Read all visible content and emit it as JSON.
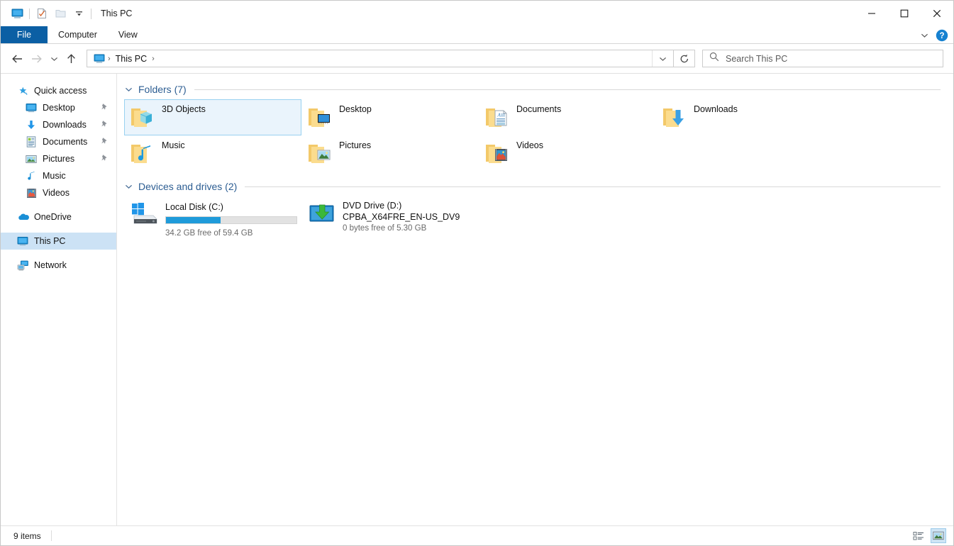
{
  "window": {
    "title": "This PC",
    "quick_access_toolbar": [
      {
        "name": "this-pc-icon",
        "tooltip": "This PC"
      },
      {
        "name": "properties-icon",
        "tooltip": "Properties"
      },
      {
        "name": "new-folder-icon",
        "tooltip": "New folder"
      },
      {
        "name": "customize-dropdown-icon",
        "tooltip": "Customize Quick Access Toolbar"
      }
    ],
    "controls": {
      "minimize": "—",
      "maximize": "□",
      "close": "✕"
    }
  },
  "ribbon": {
    "tabs": [
      {
        "label": "File",
        "active": true
      },
      {
        "label": "Computer",
        "active": false
      },
      {
        "label": "View",
        "active": false
      }
    ],
    "expand_icon": "chevron-down-icon",
    "help_label": "?"
  },
  "navigation": {
    "back_icon": "←",
    "forward_icon": "→",
    "recent_icon": "⌄",
    "up_icon": "↑",
    "breadcrumb": {
      "icon": "this-pc-icon",
      "items": [
        "This PC"
      ],
      "separator": "›"
    },
    "dropdown_icon": "chevron-down-icon",
    "refresh_icon": "↻"
  },
  "search": {
    "placeholder": "Search This PC",
    "icon": "search-icon",
    "value": ""
  },
  "sidebar": {
    "items": [
      {
        "label": "Quick access",
        "icon": "star-pin-icon",
        "indent": false,
        "pinned": false,
        "selected": false
      },
      {
        "label": "Desktop",
        "icon": "desktop-icon",
        "indent": true,
        "pinned": true,
        "selected": false
      },
      {
        "label": "Downloads",
        "icon": "download-icon",
        "indent": true,
        "pinned": true,
        "selected": false
      },
      {
        "label": "Documents",
        "icon": "documents-icon",
        "indent": true,
        "pinned": true,
        "selected": false
      },
      {
        "label": "Pictures",
        "icon": "pictures-icon",
        "indent": true,
        "pinned": true,
        "selected": false
      },
      {
        "label": "Music",
        "icon": "music-icon",
        "indent": true,
        "pinned": false,
        "selected": false
      },
      {
        "label": "Videos",
        "icon": "videos-icon",
        "indent": true,
        "pinned": false,
        "selected": false
      },
      {
        "label": "OneDrive",
        "icon": "onedrive-cloud-icon",
        "indent": false,
        "pinned": false,
        "selected": false
      },
      {
        "label": "This PC",
        "icon": "this-pc-icon",
        "indent": false,
        "pinned": false,
        "selected": true
      },
      {
        "label": "Network",
        "icon": "network-icon",
        "indent": false,
        "pinned": false,
        "selected": false
      }
    ]
  },
  "main": {
    "groups": [
      {
        "title": "Folders (7)",
        "collapsed": false,
        "items": [
          {
            "label": "3D Objects",
            "icon": "folder-3d-objects-icon",
            "selected": true
          },
          {
            "label": "Desktop",
            "icon": "folder-desktop-icon",
            "selected": false
          },
          {
            "label": "Documents",
            "icon": "folder-documents-icon",
            "selected": false
          },
          {
            "label": "Downloads",
            "icon": "folder-downloads-icon",
            "selected": false
          },
          {
            "label": "Music",
            "icon": "folder-music-icon",
            "selected": false
          },
          {
            "label": "Pictures",
            "icon": "folder-pictures-icon",
            "selected": false
          },
          {
            "label": "Videos",
            "icon": "folder-videos-icon",
            "selected": false
          }
        ]
      },
      {
        "title": "Devices and drives (2)",
        "collapsed": false,
        "drives": [
          {
            "name": "Local Disk (C:)",
            "icon": "hard-disk-icon",
            "has_bar": true,
            "used_percent": 42,
            "capacity_text": "34.2 GB free of 59.4 GB",
            "subtitle": "",
            "bar_color": "#1f9bda"
          },
          {
            "name": "DVD Drive (D:)",
            "icon": "dvd-drive-icon",
            "has_bar": false,
            "used_percent": 100,
            "capacity_text": "0 bytes free of 5.30 GB",
            "subtitle": "CPBA_X64FRE_EN-US_DV9",
            "bar_color": "#1f9bda"
          }
        ]
      }
    ]
  },
  "status": {
    "item_count": "9 items",
    "view_buttons": [
      {
        "name": "details-view-button",
        "active": false
      },
      {
        "name": "large-icons-view-button",
        "active": true
      }
    ]
  },
  "colors": {
    "accent": "#0b5fa4",
    "group_header": "#2c5d92",
    "selection_fill": "#eaf4fc",
    "selection_border": "#99d1f0",
    "sidebar_selection": "#cce2f5",
    "progress_blue": "#1f9bda",
    "folder_yellow": "#fbd77e"
  }
}
